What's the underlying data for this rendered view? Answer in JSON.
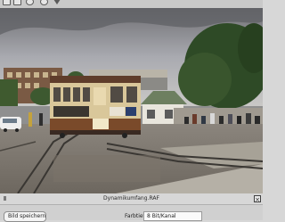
{
  "toolbar": {
    "icons": [
      "open-icon",
      "save-icon",
      "zoom-icon",
      "settings-icon",
      "warning-icon"
    ]
  },
  "image": {
    "title": "Dynamikumfang.RAF",
    "scene": "cable-car-street-photo"
  },
  "bottom": {
    "save_label": "Bild speichern...",
    "depth_label": "Farbtiefe:",
    "depth_value": "8 Bit/Kanal"
  },
  "colors": {
    "toolbar_bg": "#c9c9c9",
    "panel_bg": "#d0d0d0",
    "cable_car_body": "#d9c79a",
    "cable_car_trim": "#7a4a2a"
  }
}
